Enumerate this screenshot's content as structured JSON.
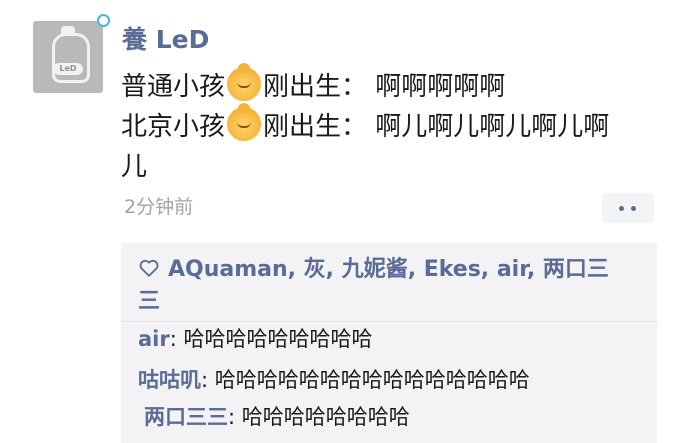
{
  "user": {
    "name": "養 LeD",
    "avatar_badge": "LeD"
  },
  "post": {
    "line1_a": "普通小孩",
    "line1_b": "刚出生：  啊啊啊啊啊",
    "line2_a": "北京小孩",
    "line2_b": "刚出生：  啊儿啊儿啊儿啊儿啊",
    "line3": "儿",
    "emoji": "baby-face"
  },
  "meta": {
    "time": "2分钟前"
  },
  "likes": {
    "text": "AQuaman, 灰, 九妮酱, Ekes, air, 两口三",
    "text_cont": "三"
  },
  "comments": [
    {
      "name": "air",
      "sep": ": ",
      "text": "哈哈哈哈哈哈哈哈哈"
    },
    {
      "name": "咕咕叽",
      "sep": ": ",
      "text": "哈哈哈哈哈哈哈哈哈哈哈哈哈哈哈"
    },
    {
      "name": "两口三三",
      "sep": ": ",
      "text": "哈哈哈哈哈哈哈哈"
    }
  ],
  "colors": {
    "name_blue": "#5b6b97",
    "panel_bg": "#f3f3f5",
    "time_gray": "#a3a3a3"
  }
}
